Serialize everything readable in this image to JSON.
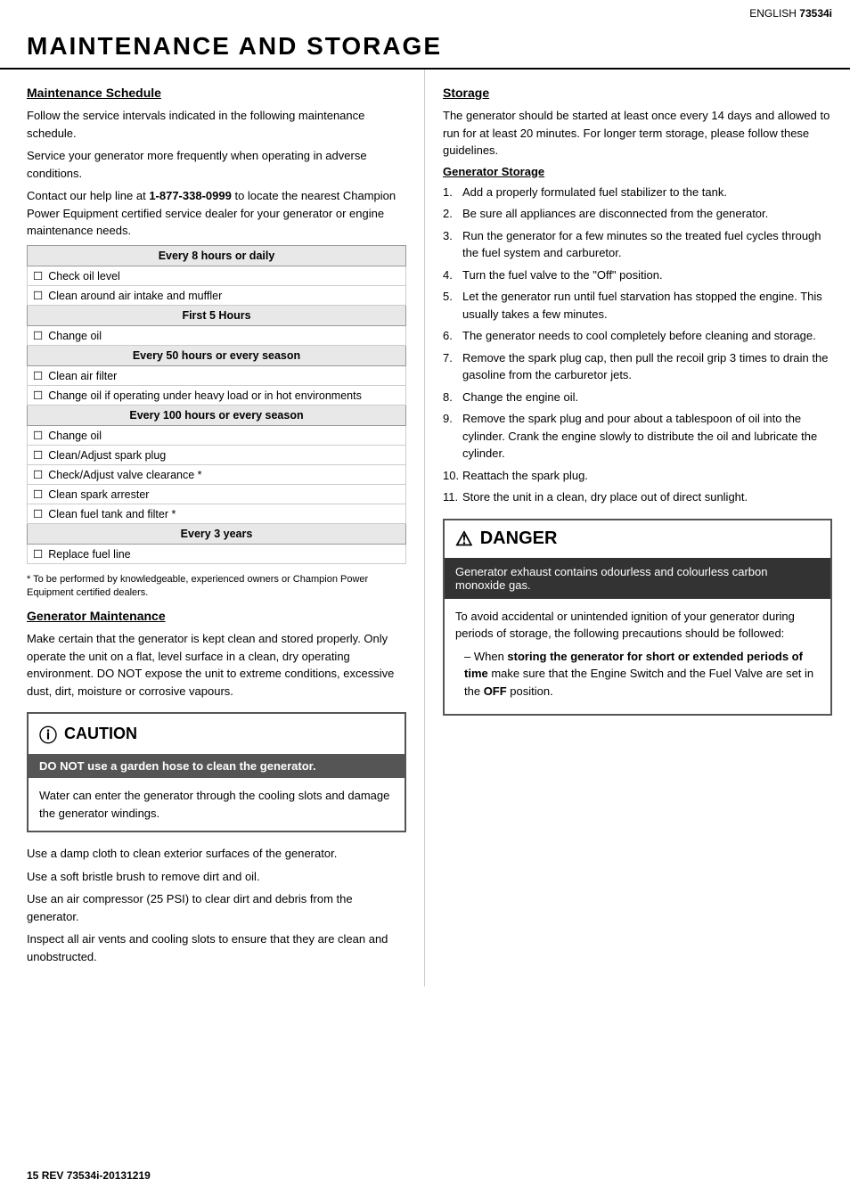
{
  "topbar": {
    "lang": "ENGLISH",
    "model": "73534i"
  },
  "title": "MAINTENANCE AND STORAGE",
  "left": {
    "maintenance_schedule_heading": "Maintenance Schedule",
    "intro1": "Follow the service intervals indicated in the following maintenance schedule.",
    "intro2": "Service your generator more frequently when operating in adverse conditions.",
    "intro3": "Contact our help line at 1-877-338-0999 to locate the nearest Champion Power Equipment certified service dealer for your generator or engine maintenance needs.",
    "table": {
      "sections": [
        {
          "header": "Every 8 hours or daily",
          "items": [
            "Check oil level",
            "Clean around air intake and muffler"
          ]
        },
        {
          "header": "First 5 Hours",
          "items": [
            "Change oil"
          ]
        },
        {
          "header": "Every 50 hours or every season",
          "items": [
            "Clean air filter",
            "Change oil if operating under heavy load or in hot environments"
          ]
        },
        {
          "header": "Every 100 hours or every season",
          "items": [
            "Change oil",
            "Clean/Adjust spark plug",
            "Check/Adjust valve clearance *",
            "Clean spark arrester",
            "Clean fuel tank and filter *"
          ]
        },
        {
          "header": "Every 3 years",
          "items": [
            "Replace fuel line"
          ]
        }
      ]
    },
    "footnote": "* To be performed by knowledgeable, experienced owners or Champion Power Equipment certified dealers.",
    "generator_maintenance_heading": "Generator Maintenance",
    "gen_maint_body": "Make certain that the generator is kept clean and stored properly. Only operate the unit on a flat, level surface in a clean, dry operating environment. DO NOT expose the unit to extreme conditions, excessive dust, dirt, moisture or corrosive vapours.",
    "caution": {
      "header": "CAUTION",
      "highlight": "DO NOT use a garden hose to clean the generator.",
      "body": "Water can enter the generator through the cooling slots and damage the generator windings."
    },
    "gen_maint_extra": [
      "Use a damp cloth to clean exterior surfaces of the generator.",
      "Use a soft bristle brush to remove dirt and oil.",
      "Use an air compressor (25 PSI) to clear dirt and debris from the generator.",
      "Inspect all air vents and cooling slots to ensure that they are clean and unobstructed."
    ]
  },
  "right": {
    "storage_heading": "Storage",
    "storage_intro": "The generator should be started at least once every 14 days and allowed to run for at least 20 minutes. For longer term storage, please follow these guidelines.",
    "generator_storage_heading": "Generator Storage",
    "storage_steps": [
      "Add a properly formulated fuel stabilizer to the tank.",
      "Be sure all appliances are disconnected from the generator.",
      "Run the generator for a few minutes so the treated fuel cycles through the fuel system and carburetor.",
      "Turn the fuel valve to the \"Off\" position.",
      "Let the generator run until fuel starvation has stopped the engine. This usually takes a few minutes.",
      "The generator needs to cool completely before cleaning and storage.",
      "Remove the spark plug cap, then pull the recoil grip 3 times to drain the gasoline from the carburetor jets.",
      "Change the engine oil.",
      "Remove the spark plug and pour about a tablespoon of oil into the cylinder. Crank the engine slowly to distribute the oil and lubricate the cylinder.",
      "Reattach the spark plug.",
      "Store the unit in a clean, dry place out of direct sunlight."
    ],
    "danger": {
      "header": "DANGER",
      "highlight": "Generator exhaust contains odourless and colourless carbon monoxide gas.",
      "body": "To avoid accidental or unintended ignition of your generator during periods of storage, the following precautions should be followed:",
      "items": [
        "When storing the generator for short or extended periods of time make sure that the Engine Switch and the Fuel Valve are set in the OFF position."
      ]
    }
  },
  "footer": {
    "page_number": "15",
    "revision": "REV 73534i-20131219"
  }
}
